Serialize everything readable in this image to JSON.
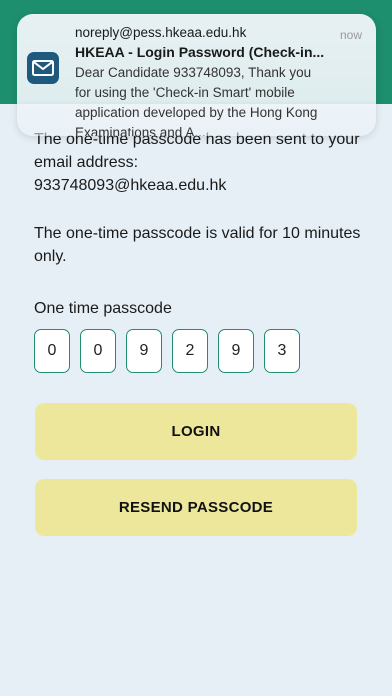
{
  "notification": {
    "sender": "noreply@pess.hkeaa.edu.hk",
    "time": "now",
    "subject": "HKEAA - Login Password (Check-in...",
    "body": "Dear Candidate 933748093, Thank you for using the 'Check-in Smart' mobile application developed by the Hong Kong Examinations and A...",
    "icon": "mail-icon"
  },
  "message": {
    "line_sent": "The one-time passcode has been sent to your email address:",
    "email": "933748093@hkeaa.edu.hk",
    "validity": "The one-time passcode is valid for 10 minutes only."
  },
  "otp": {
    "label": "One time passcode",
    "digits": [
      "0",
      "0",
      "9",
      "2",
      "9",
      "3"
    ]
  },
  "buttons": {
    "login": "LOGIN",
    "resend": "RESEND PASSCODE"
  },
  "colors": {
    "appbar": "#1d8e6e",
    "background": "#e6eff6",
    "button": "#ede79c",
    "otp_border": "#1f8f70",
    "notif_icon": "#1f5a7e"
  }
}
